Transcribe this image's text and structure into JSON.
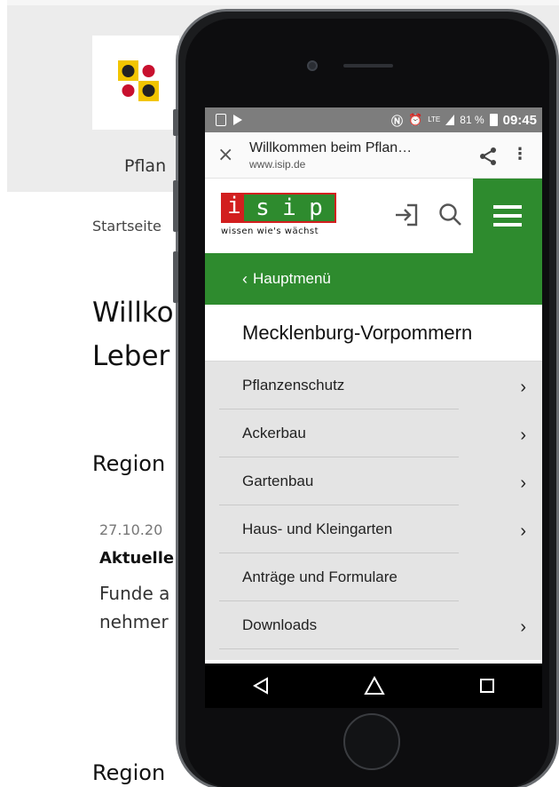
{
  "background": {
    "header_partial": "Pflan",
    "breadcrumb": "Startseite",
    "heading_line1": "Willko",
    "heading_line2": "Leber",
    "region_heading_1": "Region",
    "date": "27.10.20",
    "news_title": "Aktuelle",
    "text_line1": "Funde a",
    "text_line2": "nehmer",
    "region_heading_2": "Region"
  },
  "statusbar": {
    "battery": "81 %",
    "time": "09:45",
    "network": "LTE"
  },
  "browser": {
    "title": "Willkommen beim Pflan…",
    "url": "www.isip.de",
    "close_symbol": "×",
    "more_symbol": "⋮"
  },
  "site": {
    "logo_letter_i": "i",
    "logo_letters": [
      "s",
      "i",
      "p"
    ],
    "tagline": "wissen wie's wächst",
    "brand_color": "#2e8b2e",
    "logo_red": "#d21f1f"
  },
  "nav": {
    "back_label": "Hauptmenü",
    "back_chevron": "‹",
    "region_title": "Mecklenburg-Vorpommern",
    "items": [
      {
        "label": "Pflanzenschutz",
        "has_children": true
      },
      {
        "label": "Ackerbau",
        "has_children": true
      },
      {
        "label": "Gartenbau",
        "has_children": true
      },
      {
        "label": "Haus- und Kleingarten",
        "has_children": true
      },
      {
        "label": "Anträge und Formulare",
        "has_children": false
      },
      {
        "label": "Downloads",
        "has_children": true
      }
    ],
    "chevron_right": "›"
  }
}
